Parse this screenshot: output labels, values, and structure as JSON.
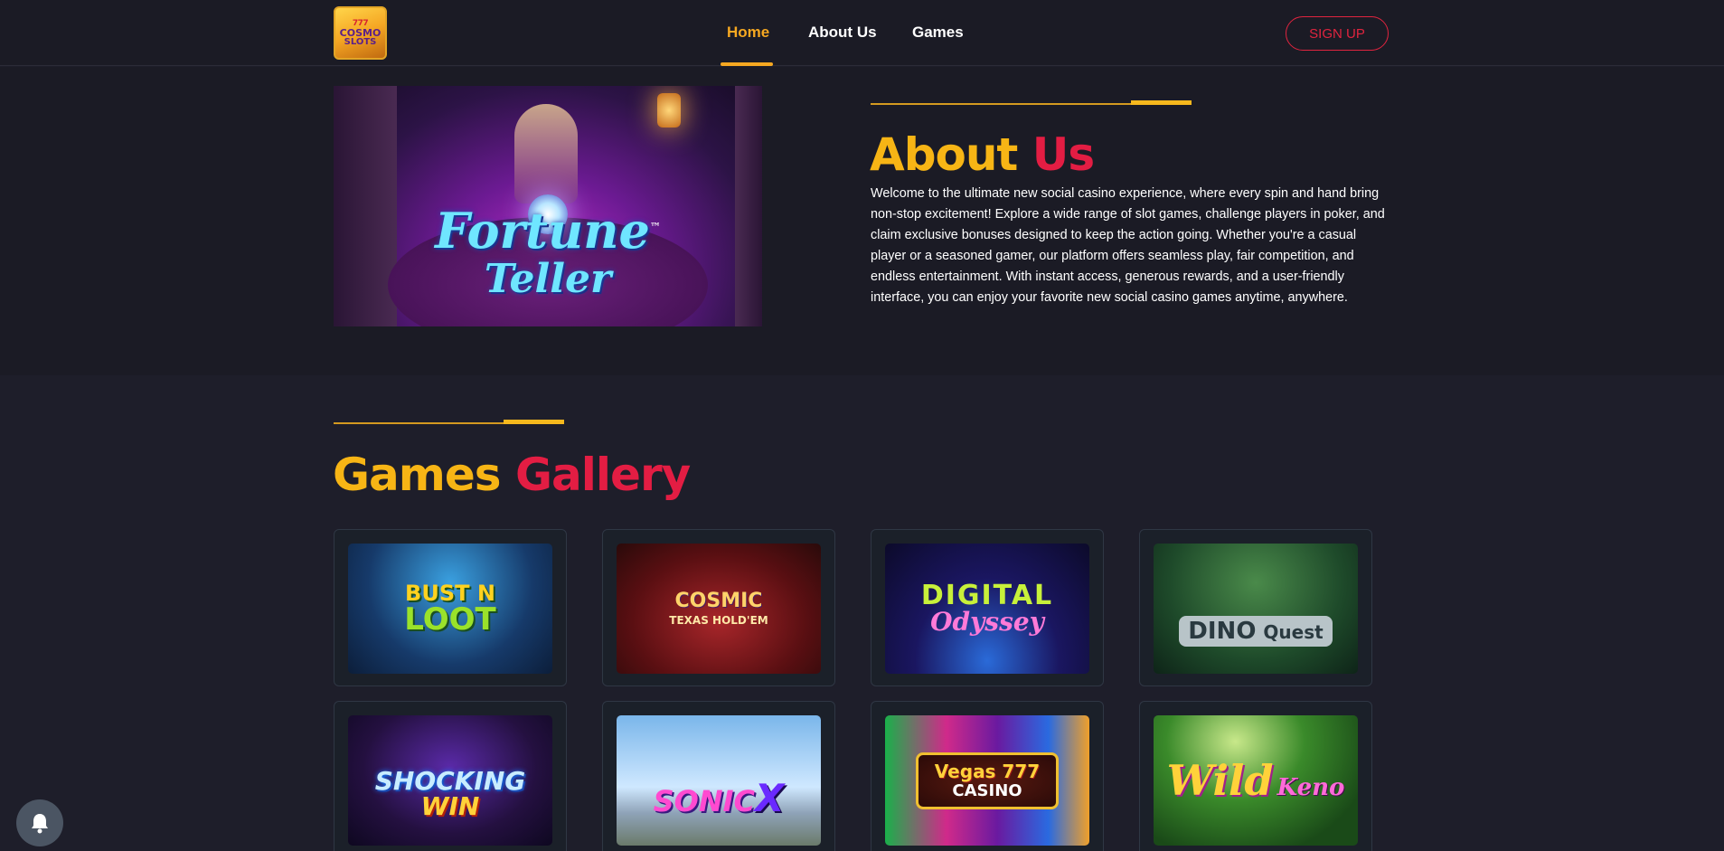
{
  "header": {
    "logo": {
      "line1": "777",
      "line2": "COSMO",
      "line3": "SLOTS"
    },
    "nav": [
      {
        "label": "Home",
        "active": true
      },
      {
        "label": "About Us",
        "active": false
      },
      {
        "label": "Games",
        "active": false
      }
    ],
    "signup_label": "SIGN UP"
  },
  "about": {
    "hero": {
      "title_line1": "Fortune",
      "title_line2": "Teller",
      "trademark": "™"
    },
    "heading_part1": "About",
    "heading_part2": "Us",
    "text": "Welcome to the ultimate new social casino experience, where every spin and hand bring non-stop excitement! Explore a wide range of slot games, challenge players in poker, and claim exclusive bonuses designed to keep the action going. Whether you're a casual player or a seasoned gamer, our platform offers seamless play, fair competition, and endless entertainment. With instant access, generous rewards, and a user-friendly interface, you can enjoy your favorite new social casino games anytime, anywhere."
  },
  "gallery": {
    "heading_part1": "Games",
    "heading_part2": "Gallery",
    "games": [
      {
        "line1": "BUST N",
        "line2": "LOOT",
        "icon": "bust-n-loot-thumbnail"
      },
      {
        "line1": "COSMIC",
        "line2": "TEXAS HOLD'EM",
        "icon": "cosmic-texas-holdem-thumbnail"
      },
      {
        "line1": "DIGITAL",
        "line2": "Odyssey",
        "icon": "digital-odyssey-thumbnail"
      },
      {
        "line1": "DINO",
        "line2": "Quest",
        "icon": "dino-quest-thumbnail"
      },
      {
        "line1": "SHOCKING",
        "line2": "WIN",
        "icon": "shocking-win-thumbnail"
      },
      {
        "line1": "SONIC",
        "line2": "X",
        "icon": "sonic-x-thumbnail"
      },
      {
        "line1": "Vegas 777",
        "line2": "CASINO",
        "icon": "vegas-777-casino-thumbnail"
      },
      {
        "line1": "Wild",
        "line2": "Keno",
        "icon": "wild-keno-thumbnail"
      }
    ]
  },
  "colors": {
    "accent_yellow": "#f7b515",
    "accent_red": "#e31d43",
    "background": "#1e1e2a"
  }
}
